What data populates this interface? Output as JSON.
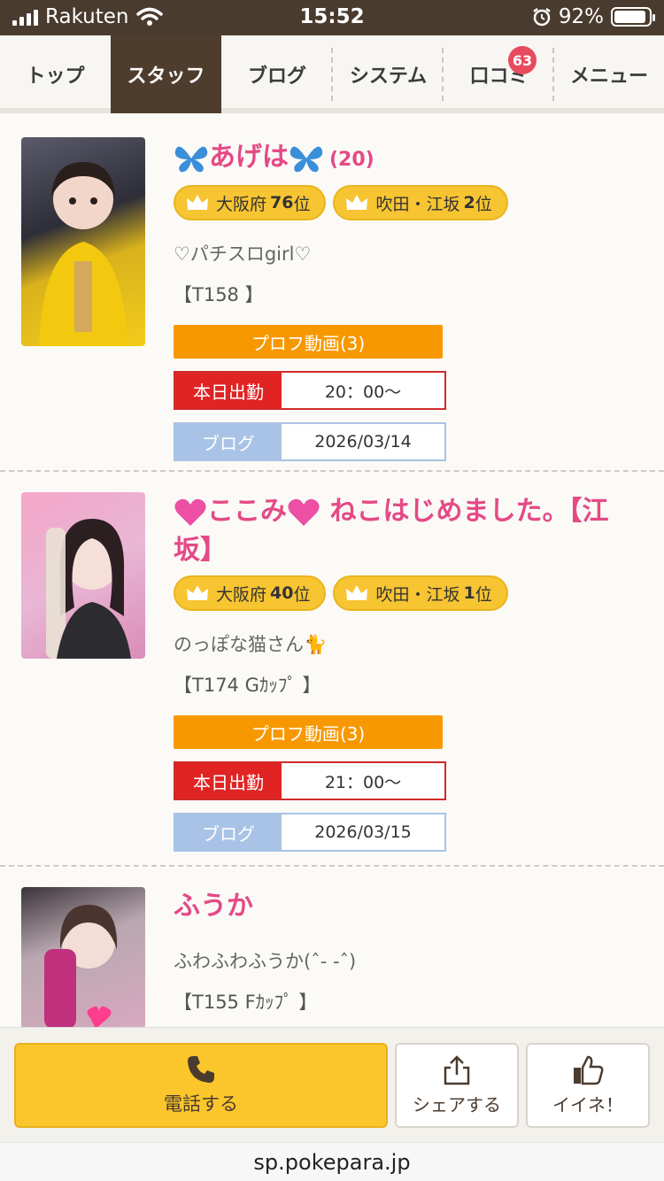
{
  "status": {
    "carrier": "Rakuten",
    "time": "15:52",
    "battery": "92%",
    "battery_level": 0.92
  },
  "tabs": [
    {
      "label": "トップ",
      "active": false
    },
    {
      "label": "スタッフ",
      "active": true
    },
    {
      "label": "ブログ",
      "active": false
    },
    {
      "label": "システム",
      "active": false
    },
    {
      "label": "口コミ",
      "active": false,
      "badge": "63"
    },
    {
      "label": "メニュー",
      "active": false
    }
  ],
  "staff": [
    {
      "name": "あげは",
      "age": "(20)",
      "ranks": [
        {
          "area": "大阪府",
          "num": "76",
          "unit": "位"
        },
        {
          "area": "吹田・江坂",
          "num": "2",
          "unit": "位"
        }
      ],
      "catch": "♡パチスロgirl♡",
      "spec": "【T158 】",
      "video": "プロフ動画(3)",
      "shift_label": "本日出勤",
      "shift_time": "20：00〜",
      "blog_label": "ブログ",
      "blog_date": "2026/03/14"
    },
    {
      "name": "ここみ",
      "name_suffix": " ねこはじめました。【江坂】",
      "ranks": [
        {
          "area": "大阪府",
          "num": "40",
          "unit": "位"
        },
        {
          "area": "吹田・江坂",
          "num": "1",
          "unit": "位"
        }
      ],
      "catch": "のっぽな猫さん🐈",
      "spec": "【T174 Gｶｯﾌﾟ 】",
      "video": "プロフ動画(3)",
      "shift_label": "本日出勤",
      "shift_time": "21：00〜",
      "blog_label": "ブログ",
      "blog_date": "2026/03/15"
    },
    {
      "name": "ふうか",
      "catch": "ふわふわふうか(ˆ- -ˆ)",
      "spec": "【T155 Fｶｯﾌﾟ 】"
    }
  ],
  "footer": {
    "call": "電話する",
    "share": "シェアする",
    "like": "イイネ！"
  },
  "url": "sp.pokepara.jp",
  "colors": {
    "brown": "#4e3c2d",
    "pink": "#e44a86",
    "orange": "#f79800",
    "red": "#e02424",
    "yellow": "#fbc52c",
    "blue": "#a9c3e6"
  }
}
